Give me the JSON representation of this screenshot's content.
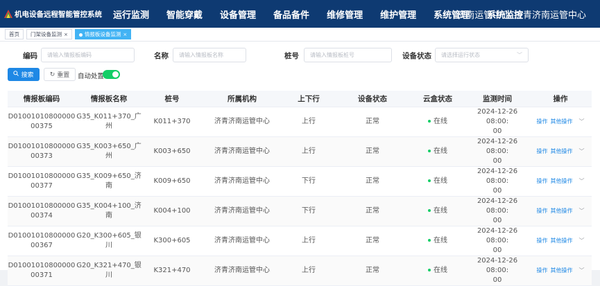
{
  "header": {
    "app_title": "机电设备远程智能管控系统",
    "nav": [
      "运行监测",
      "智能穿戴",
      "设备管理",
      "备品备件",
      "维修管理",
      "维护管理",
      "系统管理",
      "系统监控"
    ],
    "org": "济南运管中心-济青济南运管中心"
  },
  "tabs": [
    {
      "label": "首页"
    },
    {
      "label": "门架设备监测",
      "close": "×"
    },
    {
      "label": "情报板设备监测",
      "close": "×"
    }
  ],
  "filters": {
    "code_label": "编码",
    "code_placeholder": "请输入情报板编码",
    "name_label": "名称",
    "name_placeholder": "请输入情报板名称",
    "pile_label": "桩号",
    "pile_placeholder": "请输入情报板桩号",
    "status_label": "设备状态",
    "status_placeholder": "请选择运行状态"
  },
  "actions": {
    "search": "搜索",
    "reset": "重置",
    "auto_label": "自动处置:",
    "auto_enabled": true
  },
  "table": {
    "columns": [
      "情报板编码",
      "情报板名称",
      "桩号",
      "所属机构",
      "上下行",
      "设备状态",
      "云盒状态",
      "监测时间",
      "操作"
    ],
    "rows": [
      {
        "code1": "D01001010800000",
        "code2": "00375",
        "name1": "G35_K011+370_广",
        "name2": "州",
        "pile": "K011+370",
        "org": "济青济南运管中心",
        "dir": "上行",
        "status": "正常",
        "cloud": "在线",
        "time1": "2024-12-26 08:00:",
        "time2": "00"
      },
      {
        "code1": "D01001010800000",
        "code2": "00373",
        "name1": "G35_K003+650_广",
        "name2": "州",
        "pile": "K003+650",
        "org": "济青济南运管中心",
        "dir": "上行",
        "status": "正常",
        "cloud": "在线",
        "time1": "2024-12-26 08:00:",
        "time2": "00"
      },
      {
        "code1": "D01001010800000",
        "code2": "00377",
        "name1": "G35_K009+650_济",
        "name2": "南",
        "pile": "K009+650",
        "org": "济青济南运管中心",
        "dir": "下行",
        "status": "正常",
        "cloud": "在线",
        "time1": "2024-12-26 08:00:",
        "time2": "00"
      },
      {
        "code1": "D01001010800000",
        "code2": "00374",
        "name1": "G35_K004+100_济",
        "name2": "南",
        "pile": "K004+100",
        "org": "济青济南运管中心",
        "dir": "下行",
        "status": "正常",
        "cloud": "在线",
        "time1": "2024-12-26 08:00:",
        "time2": "00"
      },
      {
        "code1": "D01001010800000",
        "code2": "00367",
        "name1": "G20_K300+605_银",
        "name2": "川",
        "pile": "K300+605",
        "org": "济青济南运管中心",
        "dir": "上行",
        "status": "正常",
        "cloud": "在线",
        "time1": "2024-12-26 08:00:",
        "time2": "00"
      },
      {
        "code1": "D01001010800000",
        "code2": "00371",
        "name1": "G20_K321+470_银",
        "name2": "川",
        "pile": "K321+470",
        "org": "济青济南运管中心",
        "dir": "上行",
        "status": "正常",
        "cloud": "在线",
        "time1": "2024-12-26 08:00:",
        "time2": "00"
      }
    ],
    "op_label": "操作",
    "more_label": "其他操作"
  },
  "colors": {
    "header_bg": "#0e3a72",
    "accent": "#1e88e5",
    "online": "#13ce66",
    "active_tab": "#42b3f4"
  }
}
